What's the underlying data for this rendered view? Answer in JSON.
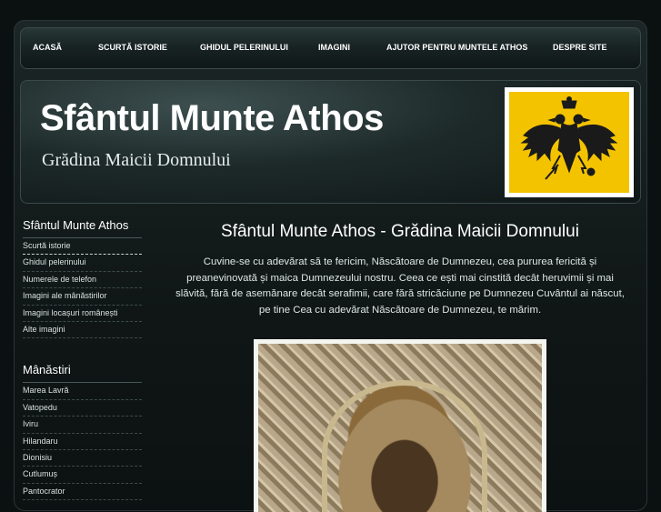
{
  "nav": {
    "items": [
      {
        "label": "ACASĂ"
      },
      {
        "label": "SCURTĂ ISTORIE"
      },
      {
        "label": "GHIDUL PELERINULUI"
      },
      {
        "label": "IMAGINI"
      },
      {
        "label": "AJUTOR PENTRU MUNTELE ATHOS"
      },
      {
        "label": "DESPRE SITE"
      }
    ]
  },
  "header": {
    "title": "Sfântul Munte Athos",
    "subtitle": "Grădina Maicii Domnului",
    "flag_color": "#f4c300",
    "flag_icon": "double-headed-eagle-icon"
  },
  "sidebar": {
    "section1": {
      "title": "Sfântul Munte Athos",
      "items": [
        {
          "label": "Scurtă istorie"
        },
        {
          "label": "Ghidul pelerinului"
        },
        {
          "label": "Numerele de telefon"
        },
        {
          "label": "Imagini ale mânăstirilor"
        },
        {
          "label": "Imagini locașuri românești"
        },
        {
          "label": "Alte imagini"
        }
      ]
    },
    "section2": {
      "title": "Mânăstiri",
      "items": [
        {
          "label": "Marea Lavră"
        },
        {
          "label": "Vatopedu"
        },
        {
          "label": "Iviru"
        },
        {
          "label": "Hilandaru"
        },
        {
          "label": "Dionisiu"
        },
        {
          "label": "Cutlumuș"
        },
        {
          "label": "Pantocrator"
        }
      ]
    }
  },
  "main": {
    "title": "Sfântul Munte Athos - Grădina Maicii Domnului",
    "text": "Cuvine-se cu adevărat să te fericim, Născătoare de Dumnezeu, cea pururea fericită și preanevinovată și maica Dumnezeului nostru. Ceea ce ești mai cinstită decât heruvimii și mai slăvită, fără de asemănare decât serafimii, care fără stricăciune pe Dumnezeu Cuvântul ai născut, pe tine Cea cu adevărat Născătoare de Dumnezeu, te mărim."
  }
}
